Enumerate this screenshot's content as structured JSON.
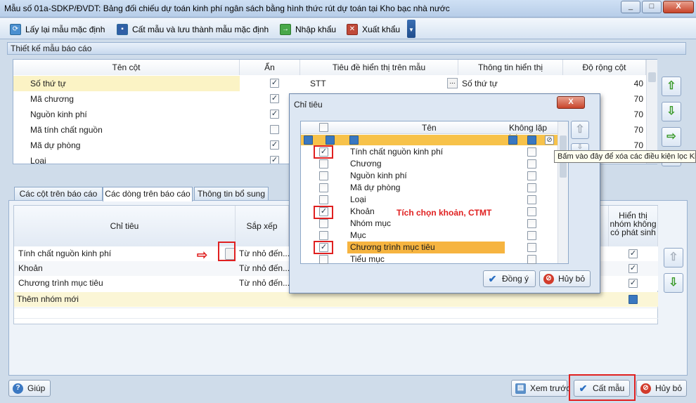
{
  "window": {
    "title": "Mẫu số 01a-SDKP/ĐVDT: Bảng đối chiếu dự toán kinh phí ngân sách bằng hình thức rút dự toán tại Kho bạc nhà nước",
    "minimize": "_",
    "maximize": "□",
    "close": "X"
  },
  "toolbar": {
    "reload": "Lấy lại mẫu mặc định",
    "save_default": "Cất mẫu và lưu thành mẫu mặc định",
    "import": "Nhập khẩu",
    "export": "Xuất khẩu"
  },
  "design": {
    "header": "Thiết kế mẫu báo cáo",
    "columns": [
      "Tên cột",
      "Ẩn",
      "Tiêu đề hiển thị trên mẫu",
      "Thông tin hiển thị",
      "Độ rộng cột"
    ],
    "rows": [
      {
        "name": "Số thứ tự",
        "hidden": true,
        "title": "STT",
        "ellipsis": "...",
        "info": "Số thứ tự",
        "width": "40"
      },
      {
        "name": "Mã chương",
        "hidden": true,
        "title": "",
        "info": "",
        "width": "70"
      },
      {
        "name": "Nguồn kinh phí",
        "hidden": true,
        "title": "",
        "info": "",
        "width": "70"
      },
      {
        "name": "Mã tính chất nguồn",
        "hidden": false,
        "title": "",
        "info": "",
        "width": "70"
      },
      {
        "name": "Mã dự phòng",
        "hidden": true,
        "title": "",
        "info": "",
        "width": "70"
      },
      {
        "name": "Loại",
        "hidden": true,
        "title": "",
        "info": "",
        "width": ""
      }
    ]
  },
  "tabs": [
    "Các cột trên báo cáo",
    "Các dòng trên báo cáo",
    "Thông tin bổ sung"
  ],
  "lower": {
    "col_indicator": "Chỉ tiêu",
    "col_sort": "Sắp xếp",
    "col_show_group": "Hiển thị nhóm không có phát sinh",
    "rows": [
      {
        "name": "Tính chất nguồn kinh phí",
        "sort": "Từ nhỏ đến..."
      },
      {
        "name": "Khoản",
        "sort": "Từ nhỏ đến..."
      },
      {
        "name": "Chương trình mục tiêu",
        "sort": "Từ nhỏ đến..."
      }
    ],
    "new_group": "Thêm nhóm mới"
  },
  "tooltip": "Bấm vào đây để xóa các điều kiện lọc Kh",
  "dialog": {
    "title": "Chỉ tiêu",
    "close": "X",
    "col_name": "Tên",
    "col_norepeat": "Không lặp lại",
    "items": [
      {
        "label": "Tính chất nguồn kinh phí",
        "checked": true
      },
      {
        "label": "Chương",
        "checked": false
      },
      {
        "label": "Nguồn kinh phí",
        "checked": false
      },
      {
        "label": "Mã dự phòng",
        "checked": false
      },
      {
        "label": "Loại",
        "checked": false
      },
      {
        "label": "Khoản",
        "checked": true
      },
      {
        "label": "Nhóm mục",
        "checked": false
      },
      {
        "label": "Mục",
        "checked": false
      },
      {
        "label": "Chương trình mục tiêu",
        "checked": true
      },
      {
        "label": "Tiểu mục",
        "checked": false
      }
    ],
    "annotation": "Tích chọn khoản, CTMT",
    "ok": "Đồng ý",
    "cancel": "Hủy bỏ"
  },
  "footer": {
    "help": "Giúp",
    "preview": "Xem trước",
    "save": "Cất mẫu",
    "cancel": "Hủy bỏ"
  },
  "colors": {
    "accent": "#f7c24a",
    "red": "#e02020",
    "green": "#3a9a2a"
  }
}
